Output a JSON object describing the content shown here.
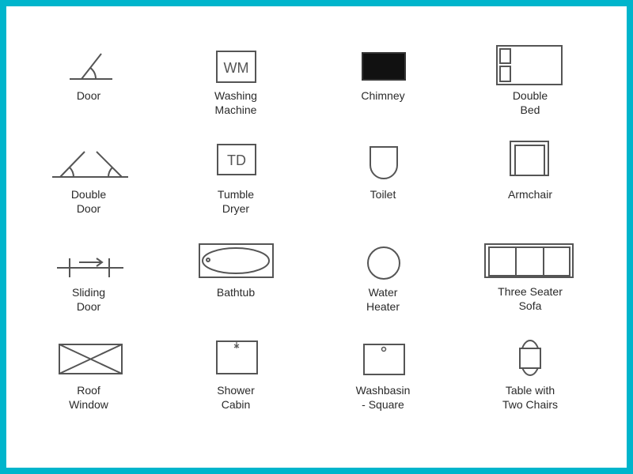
{
  "colors": {
    "border": "#00b5cc",
    "stroke": "#555555",
    "fill_chimney": "#111111"
  },
  "symbols": [
    {
      "lines": [
        "Door"
      ]
    },
    {
      "lines": [
        "Washing",
        "Machine"
      ],
      "glyph": "WM"
    },
    {
      "lines": [
        "Chimney"
      ]
    },
    {
      "lines": [
        "Double",
        "Bed"
      ]
    },
    {
      "lines": [
        "Double",
        "Door"
      ]
    },
    {
      "lines": [
        "Tumble",
        "Dryer"
      ],
      "glyph": "TD"
    },
    {
      "lines": [
        "Toilet"
      ]
    },
    {
      "lines": [
        "Armchair"
      ]
    },
    {
      "lines": [
        "Sliding",
        "Door"
      ]
    },
    {
      "lines": [
        "Bathtub"
      ]
    },
    {
      "lines": [
        "Water",
        "Heater"
      ]
    },
    {
      "lines": [
        "Three Seater",
        "Sofa"
      ]
    },
    {
      "lines": [
        "Roof",
        "Window"
      ]
    },
    {
      "lines": [
        "Shower",
        "Cabin"
      ]
    },
    {
      "lines": [
        "Washbasin",
        "- Square"
      ]
    },
    {
      "lines": [
        "Table with",
        "Two Chairs"
      ]
    }
  ]
}
